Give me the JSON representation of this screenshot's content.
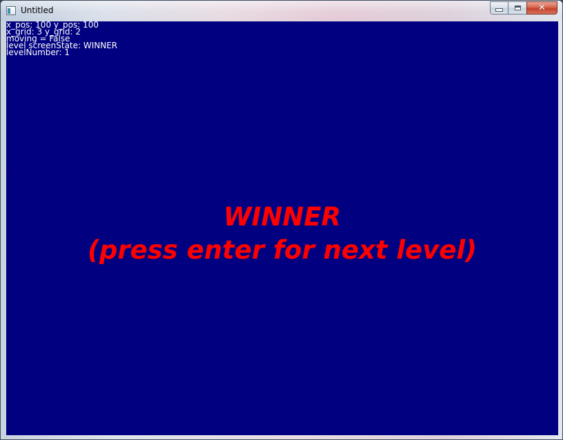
{
  "window": {
    "title": "Untitled",
    "close_glyph": "✕"
  },
  "debug": {
    "line1": "x_pos: 100 y_pos: 100",
    "line2": "x_grid: 3 y_grid: 2",
    "line3": "moving = False",
    "line4": "level screenState: WINNER",
    "line5": "levelNumber: 1"
  },
  "message": {
    "line1": "WINNER",
    "line2": "(press enter for next level)"
  },
  "colors": {
    "game_background": "#000080",
    "message_text": "#ff0000",
    "debug_text": "#ffffff"
  },
  "icons": {
    "app": "app-window-icon",
    "minimize": "minimize-icon",
    "maximize": "maximize-icon",
    "close": "close-icon"
  }
}
